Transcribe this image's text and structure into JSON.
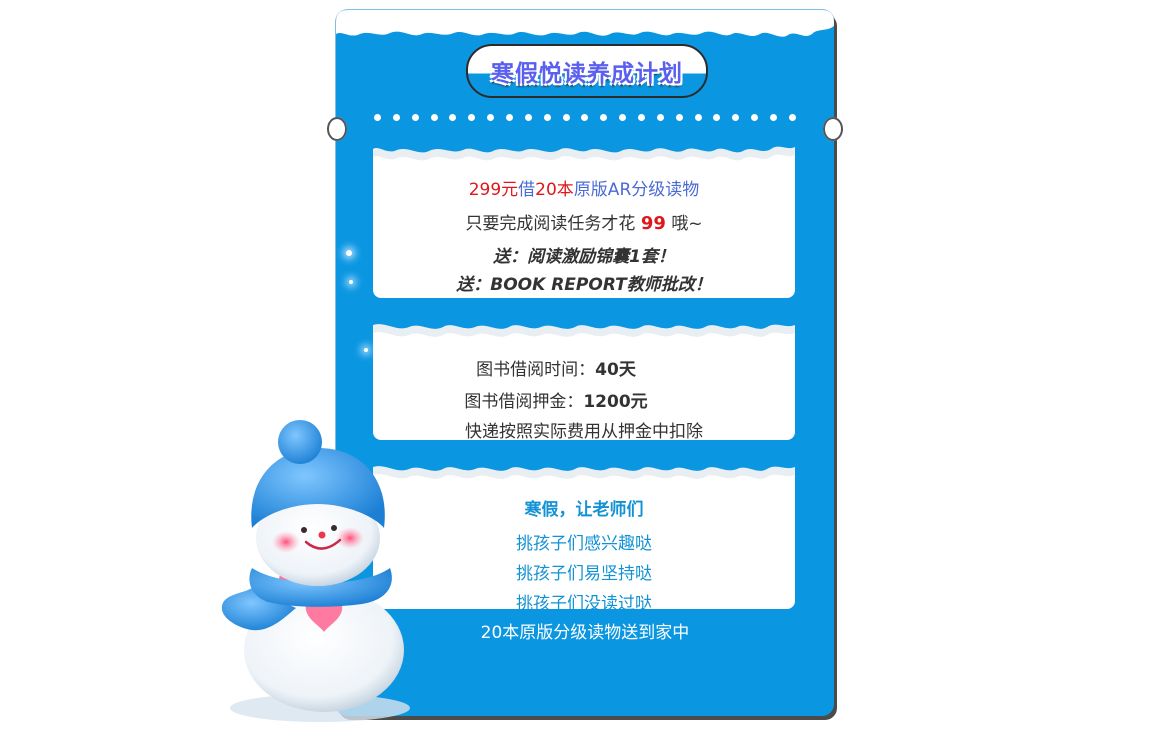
{
  "poster": {
    "title": "寒假悦读养成计划",
    "card1": {
      "line1_price": "299元",
      "line1_borrow": "借",
      "line1_count": "20本",
      "line1_rest": "原版AR分级读物",
      "line2_prefix": "只要完成阅读任务才花",
      "line2_number": "99",
      "line2_suffix": "哦~",
      "line3": "送：阅读激励锦囊1套！",
      "line4": "送：BOOK REPORT教师批改！"
    },
    "card2": {
      "time_label": "图书借阅时间：",
      "time_value": "40天",
      "deposit_label": "图书借阅押金：",
      "deposit_value": "1200元",
      "shipping_note": "快递按照实际费用从押金中扣除"
    },
    "card3": {
      "heading": "寒假，让老师们",
      "item1": "挑孩子们感兴趣哒",
      "item2": "挑孩子们易坚持哒",
      "item3": "挑孩子们没读过哒"
    },
    "bottom_text": "20本原版分级读物送到家中"
  },
  "colors": {
    "background_blue": "#0b96e2",
    "price_red": "#e0161b",
    "accent_blue": "#4a6bd6",
    "card3_text": "#1292d4",
    "title_purple": "#5a5ff0"
  },
  "decorations": {
    "snowman": "snowman-illustration",
    "snow_edge": "snow-drift-edge"
  }
}
